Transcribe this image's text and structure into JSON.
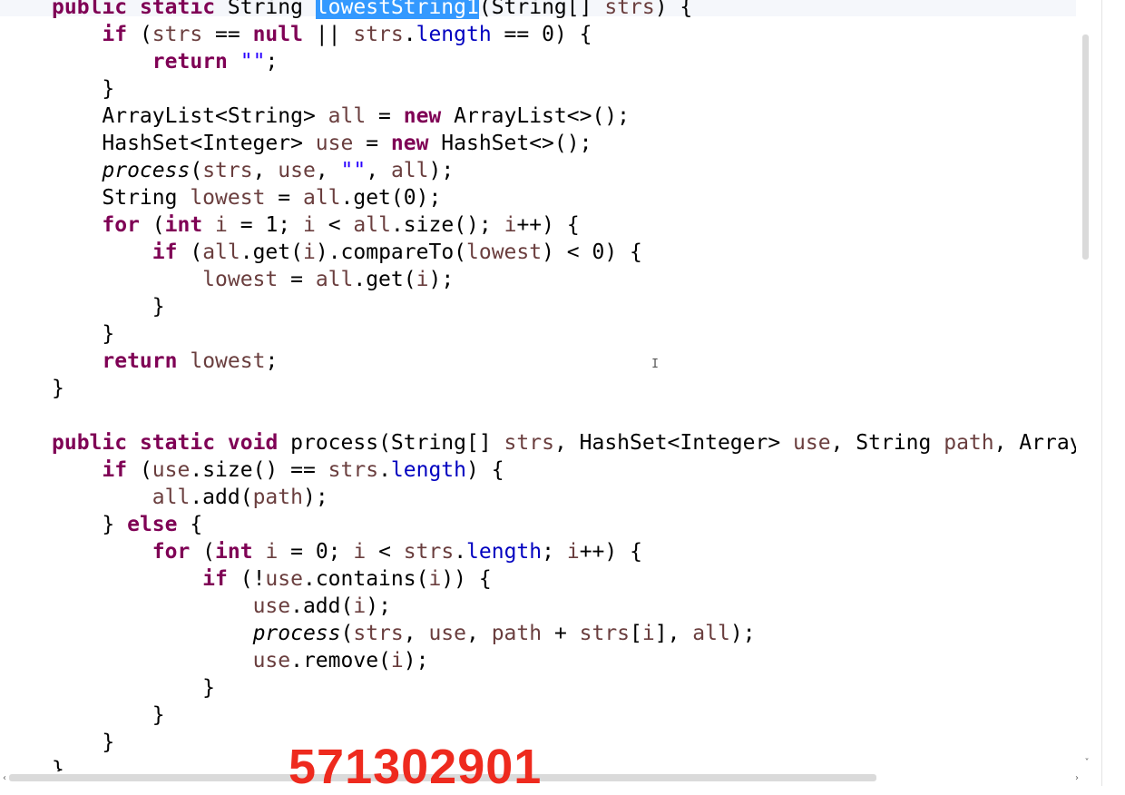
{
  "editor": {
    "lines": [
      [
        {
          "t": "public",
          "c": "kw"
        },
        {
          "t": " "
        },
        {
          "t": "static",
          "c": "kw"
        },
        {
          "t": " String "
        },
        {
          "t": "lowestString1",
          "c": "sel"
        },
        {
          "t": "(String[] "
        },
        {
          "t": "strs",
          "c": "var"
        },
        {
          "t": ") {"
        }
      ],
      [
        {
          "t": "    "
        },
        {
          "t": "if",
          "c": "kw"
        },
        {
          "t": " ("
        },
        {
          "t": "strs",
          "c": "var"
        },
        {
          "t": " == "
        },
        {
          "t": "null",
          "c": "kw"
        },
        {
          "t": " || "
        },
        {
          "t": "strs",
          "c": "var"
        },
        {
          "t": "."
        },
        {
          "t": "length",
          "c": "fld"
        },
        {
          "t": " == 0) {"
        }
      ],
      [
        {
          "t": "        "
        },
        {
          "t": "return",
          "c": "kw"
        },
        {
          "t": " "
        },
        {
          "t": "\"\"",
          "c": "str"
        },
        {
          "t": ";"
        }
      ],
      [
        {
          "t": "    }"
        }
      ],
      [
        {
          "t": "    ArrayList<String> "
        },
        {
          "t": "all",
          "c": "var"
        },
        {
          "t": " = "
        },
        {
          "t": "new",
          "c": "kw"
        },
        {
          "t": " ArrayList<>();"
        }
      ],
      [
        {
          "t": "    HashSet<Integer> "
        },
        {
          "t": "use",
          "c": "var"
        },
        {
          "t": " = "
        },
        {
          "t": "new",
          "c": "kw"
        },
        {
          "t": " HashSet<>();"
        }
      ],
      [
        {
          "t": "    "
        },
        {
          "t": "process",
          "c": "it"
        },
        {
          "t": "("
        },
        {
          "t": "strs",
          "c": "var"
        },
        {
          "t": ", "
        },
        {
          "t": "use",
          "c": "var"
        },
        {
          "t": ", "
        },
        {
          "t": "\"\"",
          "c": "str"
        },
        {
          "t": ", "
        },
        {
          "t": "all",
          "c": "var"
        },
        {
          "t": ");"
        }
      ],
      [
        {
          "t": "    String "
        },
        {
          "t": "lowest",
          "c": "var"
        },
        {
          "t": " = "
        },
        {
          "t": "all",
          "c": "var"
        },
        {
          "t": ".get(0);"
        }
      ],
      [
        {
          "t": "    "
        },
        {
          "t": "for",
          "c": "kw"
        },
        {
          "t": " ("
        },
        {
          "t": "int",
          "c": "kw"
        },
        {
          "t": " "
        },
        {
          "t": "i",
          "c": "var"
        },
        {
          "t": " = 1; "
        },
        {
          "t": "i",
          "c": "var"
        },
        {
          "t": " < "
        },
        {
          "t": "all",
          "c": "var"
        },
        {
          "t": ".size(); "
        },
        {
          "t": "i",
          "c": "var"
        },
        {
          "t": "++) {"
        }
      ],
      [
        {
          "t": "        "
        },
        {
          "t": "if",
          "c": "kw"
        },
        {
          "t": " ("
        },
        {
          "t": "all",
          "c": "var"
        },
        {
          "t": ".get("
        },
        {
          "t": "i",
          "c": "var"
        },
        {
          "t": ").compareTo("
        },
        {
          "t": "lowest",
          "c": "var"
        },
        {
          "t": ") < 0) {"
        }
      ],
      [
        {
          "t": "            "
        },
        {
          "t": "lowest",
          "c": "var"
        },
        {
          "t": " = "
        },
        {
          "t": "all",
          "c": "var"
        },
        {
          "t": ".get("
        },
        {
          "t": "i",
          "c": "var"
        },
        {
          "t": ");"
        }
      ],
      [
        {
          "t": "        }"
        }
      ],
      [
        {
          "t": "    }"
        }
      ],
      [
        {
          "t": "    "
        },
        {
          "t": "return",
          "c": "kw"
        },
        {
          "t": " "
        },
        {
          "t": "lowest",
          "c": "var"
        },
        {
          "t": ";"
        }
      ],
      [
        {
          "t": "}"
        }
      ],
      [
        {
          "t": ""
        }
      ],
      [
        {
          "t": "public",
          "c": "kw"
        },
        {
          "t": " "
        },
        {
          "t": "static",
          "c": "kw"
        },
        {
          "t": " "
        },
        {
          "t": "void",
          "c": "kw"
        },
        {
          "t": " process(String[] "
        },
        {
          "t": "strs",
          "c": "var"
        },
        {
          "t": ", HashSet<Integer> "
        },
        {
          "t": "use",
          "c": "var"
        },
        {
          "t": ", String "
        },
        {
          "t": "path",
          "c": "var"
        },
        {
          "t": ", Array"
        }
      ],
      [
        {
          "t": "    "
        },
        {
          "t": "if",
          "c": "kw"
        },
        {
          "t": " ("
        },
        {
          "t": "use",
          "c": "var"
        },
        {
          "t": ".size() == "
        },
        {
          "t": "strs",
          "c": "var"
        },
        {
          "t": "."
        },
        {
          "t": "length",
          "c": "fld"
        },
        {
          "t": ") {"
        }
      ],
      [
        {
          "t": "        "
        },
        {
          "t": "all",
          "c": "var"
        },
        {
          "t": ".add("
        },
        {
          "t": "path",
          "c": "var"
        },
        {
          "t": ");"
        }
      ],
      [
        {
          "t": "    } "
        },
        {
          "t": "else",
          "c": "kw"
        },
        {
          "t": " {"
        }
      ],
      [
        {
          "t": "        "
        },
        {
          "t": "for",
          "c": "kw"
        },
        {
          "t": " ("
        },
        {
          "t": "int",
          "c": "kw"
        },
        {
          "t": " "
        },
        {
          "t": "i",
          "c": "var"
        },
        {
          "t": " = 0; "
        },
        {
          "t": "i",
          "c": "var"
        },
        {
          "t": " < "
        },
        {
          "t": "strs",
          "c": "var"
        },
        {
          "t": "."
        },
        {
          "t": "length",
          "c": "fld"
        },
        {
          "t": "; "
        },
        {
          "t": "i",
          "c": "var"
        },
        {
          "t": "++) {"
        }
      ],
      [
        {
          "t": "            "
        },
        {
          "t": "if",
          "c": "kw"
        },
        {
          "t": " (!"
        },
        {
          "t": "use",
          "c": "var"
        },
        {
          "t": ".contains("
        },
        {
          "t": "i",
          "c": "var"
        },
        {
          "t": ")) {"
        }
      ],
      [
        {
          "t": "                "
        },
        {
          "t": "use",
          "c": "var"
        },
        {
          "t": ".add("
        },
        {
          "t": "i",
          "c": "var"
        },
        {
          "t": ");"
        }
      ],
      [
        {
          "t": "                "
        },
        {
          "t": "process",
          "c": "it"
        },
        {
          "t": "("
        },
        {
          "t": "strs",
          "c": "var"
        },
        {
          "t": ", "
        },
        {
          "t": "use",
          "c": "var"
        },
        {
          "t": ", "
        },
        {
          "t": "path",
          "c": "var"
        },
        {
          "t": " + "
        },
        {
          "t": "strs",
          "c": "var"
        },
        {
          "t": "["
        },
        {
          "t": "i",
          "c": "var"
        },
        {
          "t": "], "
        },
        {
          "t": "all",
          "c": "var"
        },
        {
          "t": ");"
        }
      ],
      [
        {
          "t": "                "
        },
        {
          "t": "use",
          "c": "var"
        },
        {
          "t": ".remove("
        },
        {
          "t": "i",
          "c": "var"
        },
        {
          "t": ");"
        }
      ],
      [
        {
          "t": "            }"
        }
      ],
      [
        {
          "t": "        }"
        }
      ],
      [
        {
          "t": "    }"
        }
      ],
      [
        {
          "t": "}"
        }
      ]
    ]
  },
  "scrollbars": {
    "vertical_down_glyph": "˅",
    "horizontal_left_glyph": "‹",
    "horizontal_right_glyph": "›"
  },
  "cursor_glyph": "I",
  "watermark": {
    "text": "571302901",
    "color": "#ee2a1e"
  },
  "colors": {
    "keyword": "#7f0055",
    "variable": "#6a3e3e",
    "field": "#0000c0",
    "string": "#2a00ff",
    "selection": "#3399ff"
  }
}
